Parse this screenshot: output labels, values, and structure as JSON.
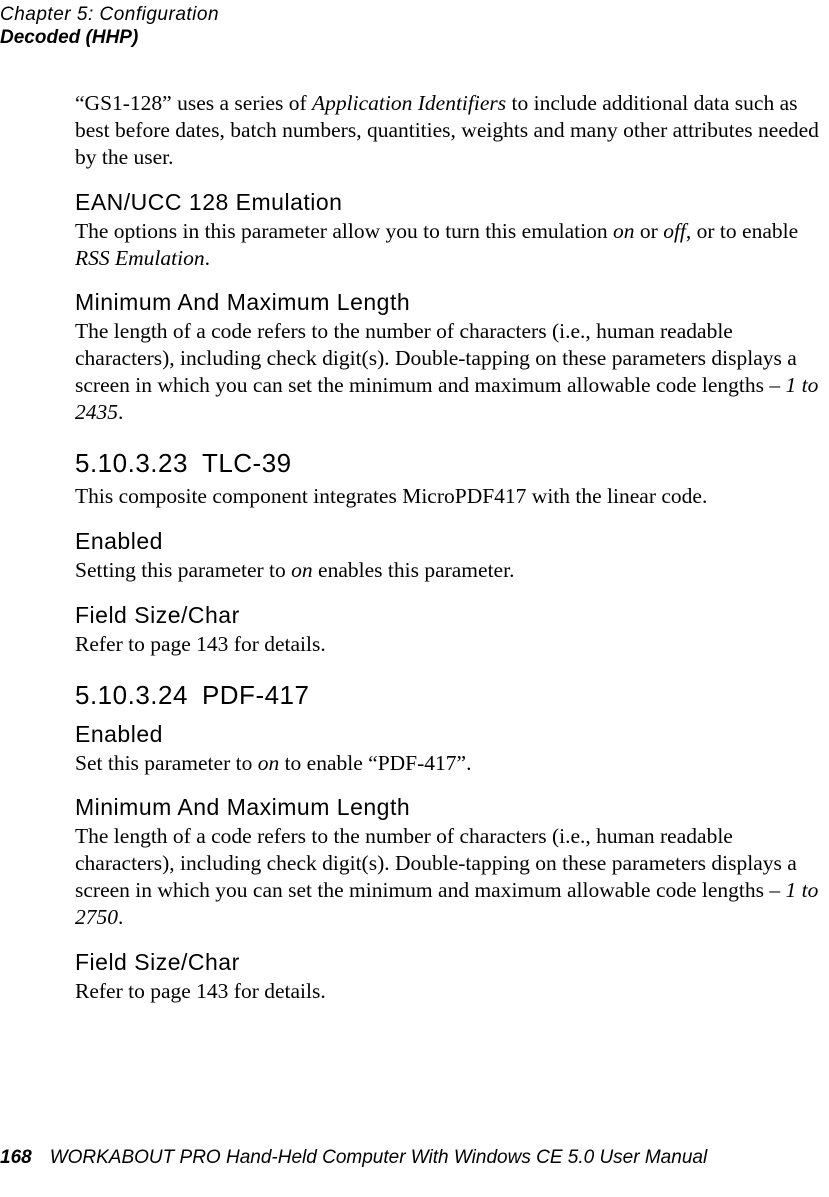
{
  "header": {
    "line1": "Chapter 5: Configuration",
    "line2": "Decoded (HHP)"
  },
  "content": {
    "p1_a": "“GS1-128” uses a series of ",
    "p1_b": "Application Identifiers",
    "p1_c": " to include additional data such as best before dates, batch numbers, quantities, weights and many other attributes needed by the user.",
    "h1": "EAN/UCC 128 Emulation",
    "p2_a": "The options in this parameter allow you to turn this emulation ",
    "p2_b": "on",
    "p2_c": " or ",
    "p2_d": "off",
    "p2_e": ", or to enable ",
    "p2_f": "RSS Emulation",
    "p2_g": ".",
    "h2": "Minimum And Maximum Length",
    "p3_a": "The length of a code refers to the number of characters (i.e., human readable characters), including check digit(s). Double-tapping on these parameters displays a screen in which you can set the minimum and maximum allowable code lengths – ",
    "p3_b": "1 to 2435",
    "p3_c": ".",
    "sec1_num": "5.10.3.23",
    "sec1_title": "TLC-39",
    "p4": "This composite component integrates MicroPDF417 with the linear code.",
    "h3": "Enabled",
    "p5_a": "Setting this parameter to ",
    "p5_b": "on",
    "p5_c": " enables this parameter.",
    "h4": "Field Size/Char",
    "p6": "Refer to page 143 for details.",
    "sec2_num": "5.10.3.24",
    "sec2_title": "PDF-417",
    "h5": "Enabled",
    "p7_a": "Set this parameter to ",
    "p7_b": "on",
    "p7_c": " to enable “PDF-417”.",
    "h6": "Minimum And Maximum Length",
    "p8_a": "The length of a code refers to the number of characters (i.e., human readable characters), including check digit(s). Double-tapping on these parameters displays a screen in which you can set the minimum and maximum allowable code lengths – ",
    "p8_b": "1 to 2750",
    "p8_c": ".",
    "h7": "Field Size/Char",
    "p9": "Refer to page 143 for details."
  },
  "footer": {
    "pagenum": "168",
    "text": "WORKABOUT PRO Hand-Held Computer With Windows CE 5.0 User Manual"
  }
}
